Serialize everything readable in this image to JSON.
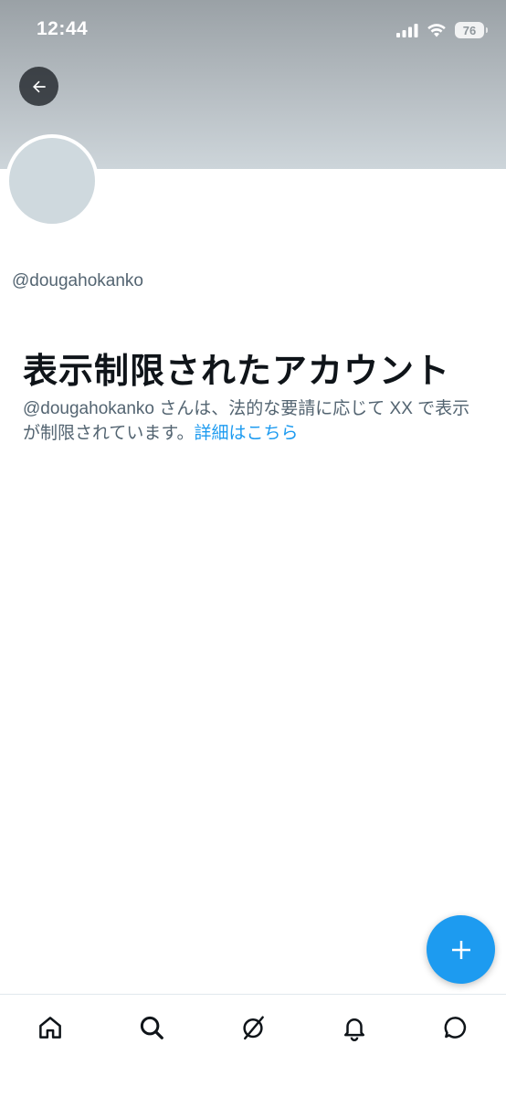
{
  "status_bar": {
    "time": "12:44",
    "battery": "76",
    "icons": [
      "signal-icon",
      "wifi-icon",
      "battery-icon"
    ]
  },
  "header": {
    "back_icon": "arrow-left-icon"
  },
  "profile": {
    "handle": "@dougahokanko"
  },
  "restricted": {
    "title": "表示制限されたアカウント",
    "description": "@dougahokanko さんは、法的な要請に応じて XX で表示が制限されています。",
    "learn_more": "詳細はこちら"
  },
  "fab": {
    "icon": "plus-icon"
  },
  "nav": {
    "items": [
      "home-icon",
      "search-icon",
      "grok-icon",
      "notifications-bell-icon",
      "messages-icon"
    ]
  },
  "colors": {
    "accent": "#1d9bf0",
    "text_primary": "#0f1419",
    "text_secondary": "#536471",
    "avatar_placeholder": "#cfd9de"
  }
}
